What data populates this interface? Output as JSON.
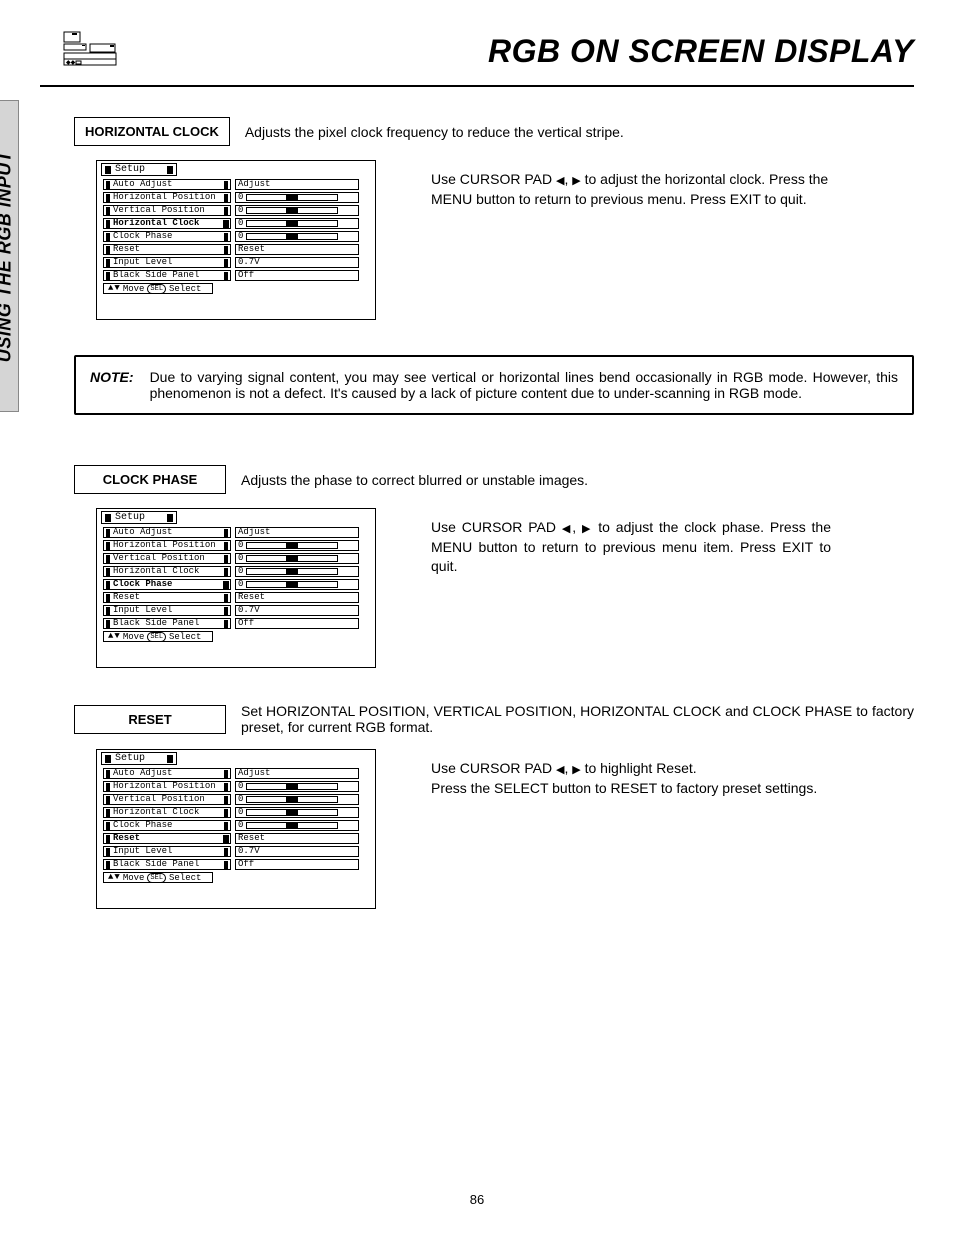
{
  "header": {
    "title": "RGB ON SCREEN DISPLAY"
  },
  "side_tab": "USING THE RGB INPUT",
  "page_number": "86",
  "note": {
    "label": "NOTE:",
    "text": "Due to varying signal content, you may see vertical or horizontal lines bend occasionally in RGB mode.  However, this phenomenon is not a defect.  It's caused by a lack of picture content due to under-scanning in RGB mode."
  },
  "sections": [
    {
      "label": "HORIZONTAL CLOCK",
      "desc": "Adjusts the pixel clock frequency to reduce the vertical stripe.",
      "instruction": "Use CURSOR PAD ◀, ▶ to adjust the horizontal clock.  Press the MENU button to return to previous menu.  Press EXIT to quit.",
      "justify": false,
      "selected_row": "Horizontal Clock"
    },
    {
      "label": "CLOCK PHASE",
      "desc": "Adjusts the phase to correct blurred or unstable images.",
      "instruction": "Use CURSOR PAD ◀, ▶ to adjust the clock phase.  Press the MENU button to return to previous menu item.  Press EXIT to quit.",
      "justify": true,
      "selected_row": "Clock Phase"
    },
    {
      "label": "RESET",
      "desc": "Set HORIZONTAL POSITION, VERTICAL POSITION, HORIZONTAL CLOCK  and CLOCK PHASE to factory preset, for current RGB format.",
      "instruction": "Use CURSOR PAD ◀, ▶ to highlight Reset.\nPress the SELECT button to RESET to factory preset settings.",
      "justify": false,
      "selected_row": "Reset"
    }
  ],
  "osd": {
    "title": "Setup",
    "hint_move": "Move",
    "hint_select": "Select",
    "rows": [
      {
        "label": "Auto Adjust",
        "value": "Adjust",
        "type": "text"
      },
      {
        "label": "Horizontal Position",
        "value": "0",
        "type": "slider"
      },
      {
        "label": "Vertical Position",
        "value": "0",
        "type": "slider"
      },
      {
        "label": "Horizontal Clock",
        "value": "0",
        "type": "slider"
      },
      {
        "label": "Clock Phase",
        "value": "0",
        "type": "slider"
      },
      {
        "label": "Reset",
        "value": "Reset",
        "type": "text"
      },
      {
        "label": "Input Level",
        "value": "0.7V",
        "type": "text"
      },
      {
        "label": "Black Side Panel",
        "value": "Off",
        "type": "text"
      }
    ]
  },
  "colors": {
    "side_bg": "#d5d5d5"
  }
}
